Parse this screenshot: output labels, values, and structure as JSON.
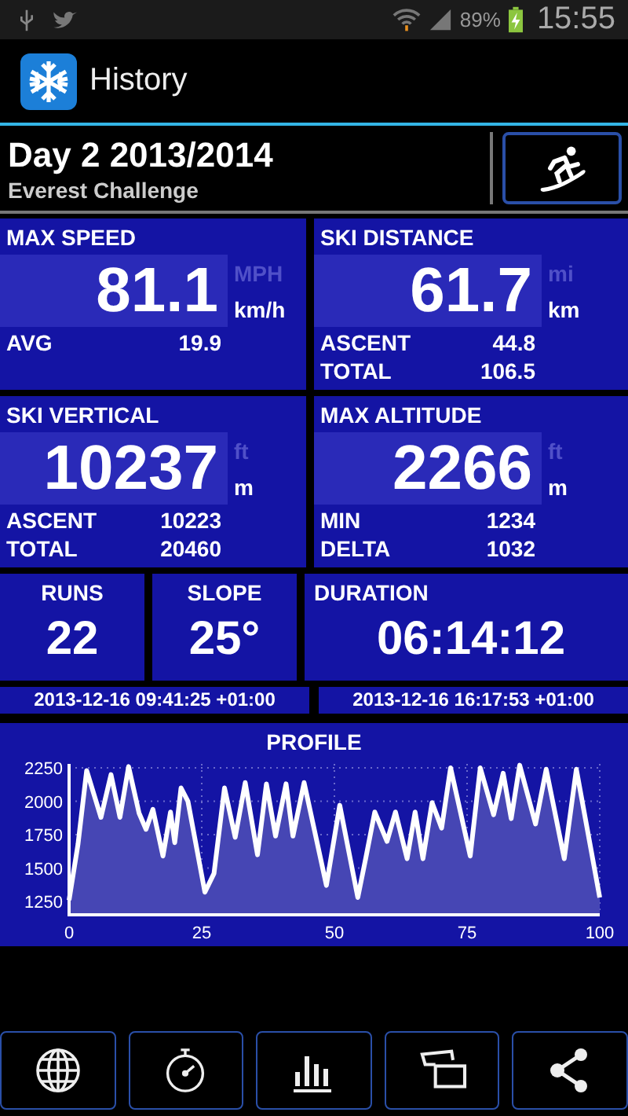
{
  "status_bar": {
    "battery": "89%",
    "time": "15:55"
  },
  "app_bar": {
    "title": "History"
  },
  "header": {
    "title": "Day 2 2013/2014",
    "subtitle": "Everest Challenge"
  },
  "stats": [
    {
      "label": "MAX SPEED",
      "value": "81.1",
      "units": [
        {
          "label": "MPH",
          "selected": false
        },
        {
          "label": "km/h",
          "selected": true
        }
      ],
      "details": [
        {
          "label": "AVG",
          "value": "19.9"
        }
      ]
    },
    {
      "label": "SKI DISTANCE",
      "value": "61.7",
      "units": [
        {
          "label": "mi",
          "selected": false
        },
        {
          "label": "km",
          "selected": true
        }
      ],
      "details": [
        {
          "label": "ASCENT",
          "value": "44.8"
        },
        {
          "label": "TOTAL",
          "value": "106.5"
        }
      ]
    },
    {
      "label": "SKI VERTICAL",
      "value": "10237",
      "units": [
        {
          "label": "ft",
          "selected": false
        },
        {
          "label": "m",
          "selected": true
        }
      ],
      "details": [
        {
          "label": "ASCENT",
          "value": "10223"
        },
        {
          "label": "TOTAL",
          "value": "20460"
        }
      ]
    },
    {
      "label": "MAX ALTITUDE",
      "value": "2266",
      "units": [
        {
          "label": "ft",
          "selected": false
        },
        {
          "label": "m",
          "selected": true
        }
      ],
      "details": [
        {
          "label": "MIN",
          "value": "1234"
        },
        {
          "label": "DELTA",
          "value": "1032"
        }
      ]
    }
  ],
  "counters": [
    {
      "label": "RUNS",
      "value": "22"
    },
    {
      "label": "SLOPE",
      "value": "25°"
    },
    {
      "label": "DURATION",
      "value": "06:14:12"
    }
  ],
  "times": [
    "2013-12-16 09:41:25 +01:00",
    "2013-12-16 16:17:53 +01:00"
  ],
  "profile": {
    "chart_data": {
      "type": "area",
      "title": "PROFILE",
      "x": [
        0,
        1.7,
        3.3,
        6,
        7.9,
        9.6,
        11.2,
        13.2,
        14.5,
        15.8,
        17.7,
        19.1,
        19.9,
        21.1,
        22.4,
        25.6,
        27.3,
        29.3,
        31.3,
        33.2,
        35.5,
        37.2,
        38.9,
        40.9,
        42.2,
        44.3,
        48.5,
        51,
        54.4,
        55.9,
        57.6,
        59.9,
        61.5,
        63.7,
        65.2,
        66.7,
        68.4,
        70.2,
        71.9,
        75.6,
        77.5,
        80,
        81.8,
        83.3,
        84.9,
        87.9,
        89.9,
        93.3,
        95.6,
        100
      ],
      "series": [
        {
          "color": "#ffffff",
          "values": [
            1260,
            1680,
            2230,
            1880,
            2200,
            1880,
            2260,
            1910,
            1790,
            1940,
            1590,
            1920,
            1690,
            2100,
            2000,
            1320,
            1460,
            2100,
            1730,
            2140,
            1600,
            2130,
            1740,
            2130,
            1740,
            2140,
            1370,
            1970,
            1280,
            1570,
            1920,
            1700,
            1920,
            1570,
            1920,
            1570,
            1990,
            1800,
            2250,
            1590,
            2250,
            1900,
            2210,
            1870,
            2270,
            1830,
            2240,
            1570,
            2240,
            1280
          ]
        }
      ],
      "grid": true,
      "xlim": [
        0,
        100
      ],
      "ylim": [
        1150,
        2280
      ],
      "xticks": [
        0,
        25,
        50,
        75,
        100
      ],
      "yticks": [
        1250,
        1500,
        1750,
        2000,
        2250
      ]
    }
  }
}
